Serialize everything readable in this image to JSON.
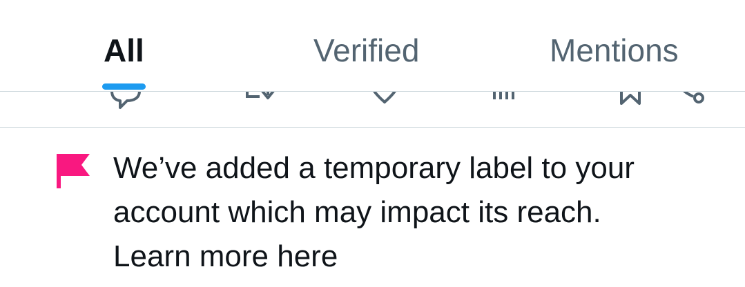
{
  "tabs": [
    {
      "label": "All",
      "active": true
    },
    {
      "label": "Verified",
      "active": false
    },
    {
      "label": "Mentions",
      "active": false
    }
  ],
  "actions": [
    {
      "icon": "reply-icon"
    },
    {
      "icon": "repost-icon"
    },
    {
      "icon": "like-icon"
    },
    {
      "icon": "views-icon"
    },
    {
      "icon": "bookmark-icon"
    },
    {
      "icon": "share-icon"
    }
  ],
  "notice": {
    "icon": "flag-icon",
    "line1": "We’ve added a temporary label to your",
    "line2": "account which may impact its reach.",
    "link": "Learn more here"
  },
  "colors": {
    "accent": "#1d9bf0",
    "flag": "#f91880",
    "text": "#0f1419",
    "secondary": "#536471",
    "divider": "#cfd9de"
  }
}
